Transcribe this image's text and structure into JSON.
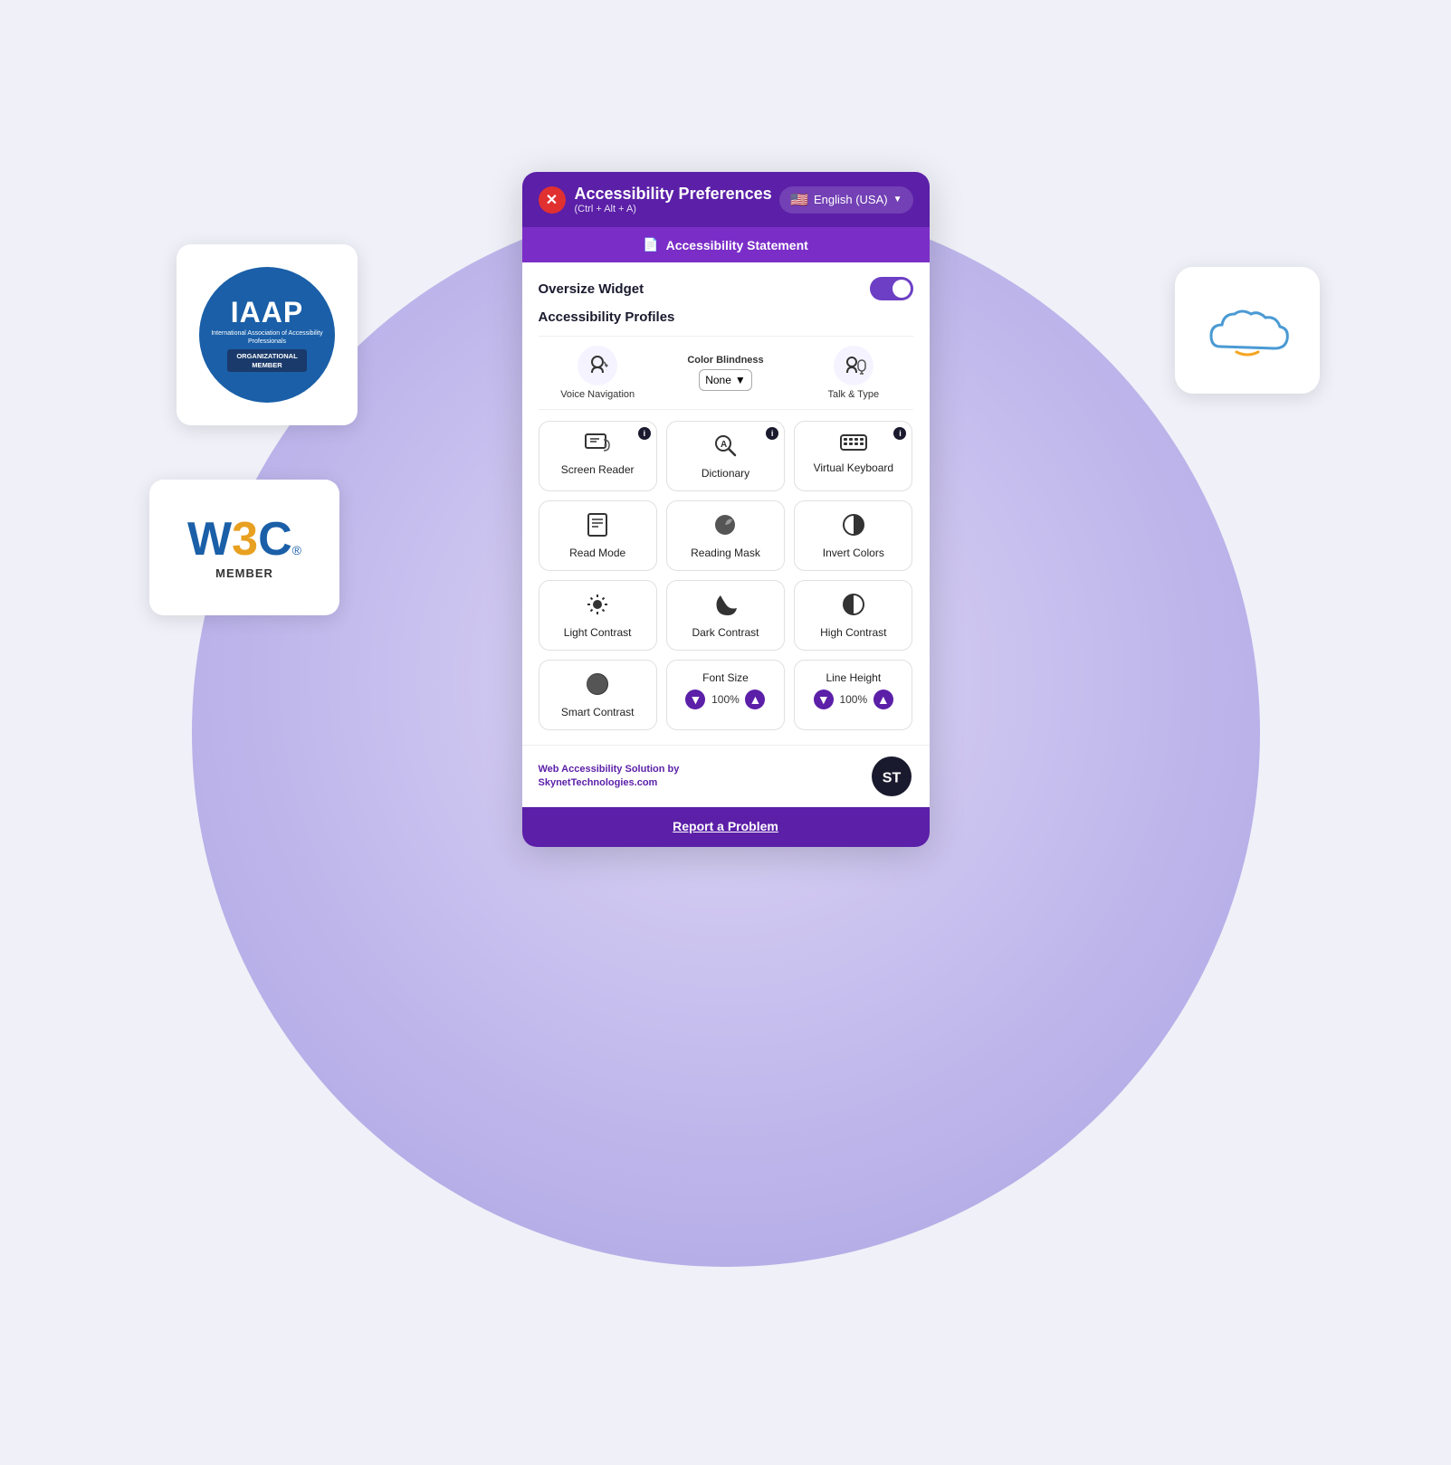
{
  "page": {
    "background_circle_color": "#c8c0ee"
  },
  "iaap": {
    "main_text": "IAAP",
    "sub_text": "International Association of Accessibility Professionals",
    "org_line1": "ORGANIZATIONAL",
    "org_line2": "MEMBER"
  },
  "w3c": {
    "logo": "W3C",
    "reg": "®",
    "member": "MEMBER"
  },
  "panel": {
    "header": {
      "title": "Accessibility Preferences",
      "shortcut": "(Ctrl + Alt + A)",
      "language": "English (USA)",
      "close_icon": "✕"
    },
    "stmt_bar": {
      "icon": "📄",
      "label": "Accessibility Statement"
    },
    "oversize_widget": {
      "label": "Oversize Widget"
    },
    "accessibility_profiles": {
      "section_label": "Accessibility Profiles"
    },
    "profiles": [
      {
        "icon": "🎤",
        "label": "Voice Navigation"
      },
      {
        "icon": "👁️‍🗨️",
        "label": "Color Blindness",
        "type": "select",
        "options": [
          "None"
        ]
      },
      {
        "icon": "💬",
        "label": "Talk & Type"
      }
    ],
    "features": [
      {
        "id": "screen-reader",
        "icon": "📺",
        "label": "Screen Reader",
        "has_info": true
      },
      {
        "id": "dictionary",
        "icon": "🔍",
        "label": "Dictionary",
        "has_info": true
      },
      {
        "id": "virtual-keyboard",
        "icon": "⌨️",
        "label": "Virtual Keyboard",
        "has_info": true
      },
      {
        "id": "read-mode",
        "icon": "📋",
        "label": "Read Mode",
        "has_info": false
      },
      {
        "id": "reading-mask",
        "icon": "🔵",
        "label": "Reading Mask",
        "has_info": false
      },
      {
        "id": "invert-colors",
        "icon": "◑",
        "label": "Invert Colors",
        "has_info": false
      },
      {
        "id": "light-contrast",
        "icon": "☀️",
        "label": "Light Contrast",
        "has_info": false
      },
      {
        "id": "dark-contrast",
        "icon": "🌙",
        "label": "Dark Contrast",
        "has_info": false
      },
      {
        "id": "high-contrast",
        "icon": "◐",
        "label": "High Contrast",
        "has_info": false
      }
    ],
    "bottom_row": [
      {
        "id": "smart-contrast",
        "icon": "◕",
        "label": "Smart Contrast"
      },
      {
        "id": "font-size",
        "label": "Font Size",
        "value": "100%"
      },
      {
        "id": "line-height",
        "label": "Line Height",
        "value": "100%"
      }
    ],
    "footer": {
      "line1": "Web Accessibility Solution by",
      "line2": "SkynetTechnologies.com"
    },
    "report": {
      "label": "Report a Problem"
    }
  }
}
